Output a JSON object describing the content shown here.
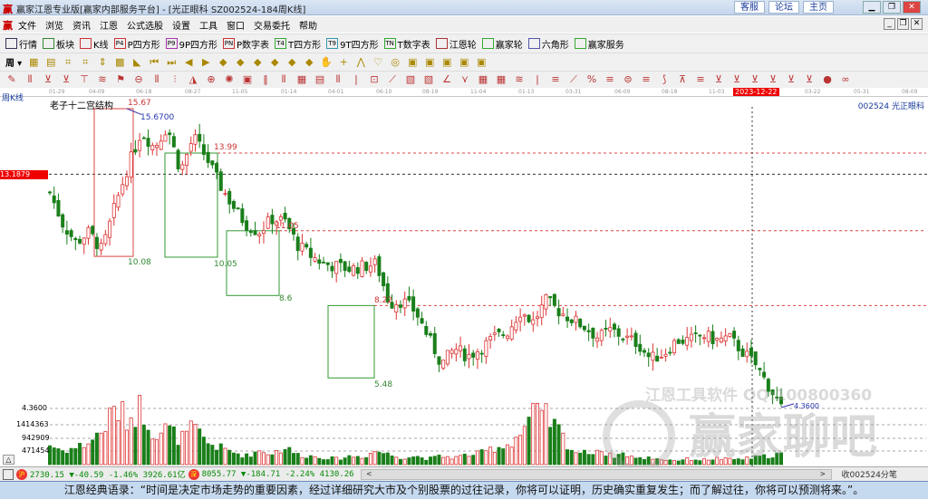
{
  "window": {
    "title": "赢家江恩专业版[赢家内部服务平台] - [光正眼科   SZ002524-184周K线]",
    "links": [
      "客服",
      "论坛",
      "主页"
    ]
  },
  "menu": [
    "文件",
    "浏览",
    "资讯",
    "江恩",
    "公式选股",
    "设置",
    "工具",
    "窗口",
    "交易委托",
    "帮助"
  ],
  "toolbar": [
    {
      "icon": "grid-icon",
      "label": "行情"
    },
    {
      "icon": "blocks-icon",
      "label": "板块"
    },
    {
      "icon": "candles-icon",
      "label": "K线"
    },
    {
      "icon": "P4",
      "label": "P四方形"
    },
    {
      "icon": "P9",
      "label": "9P四方形"
    },
    {
      "icon": "PN",
      "label": "P数字表"
    },
    {
      "icon": "T4",
      "label": "T四方形"
    },
    {
      "icon": "T9",
      "label": "9T四方形"
    },
    {
      "icon": "TN",
      "label": "T数字表"
    },
    {
      "icon": "target-icon",
      "label": "江恩轮"
    },
    {
      "icon": "wheel-icon",
      "label": "赢家轮"
    },
    {
      "icon": "hexagon-icon",
      "label": "六角形"
    },
    {
      "icon": "dollar-icon",
      "label": "赢家服务"
    }
  ],
  "period_select": "周",
  "chart": {
    "period_label": "周K线",
    "structure_label": "老子十二宫结构",
    "stock": "002524  光正眼科",
    "cursor_price": "13.1879",
    "cursor_date": "2023-12-22",
    "dates": [
      "01-29",
      "04-09",
      "06-18",
      "08-27",
      "11-05",
      "01-14",
      "04-01",
      "06-10",
      "08-19",
      "11-04",
      "01-13",
      "03-31",
      "06-09",
      "08-18",
      "11-03",
      "03-22",
      "05-31",
      "08-09"
    ],
    "high_label": "15.6700",
    "low_label": "4.3600",
    "box_labels": {
      "top1": "15.67",
      "bot1": "10.08",
      "top2": "13.99",
      "bot2": "10.05",
      "top3": "11.05",
      "bot3": "8.6",
      "top4": "8.22",
      "bot4": "5.48"
    },
    "volume_ticks": [
      "4.3600",
      "1414363",
      "942909",
      "471454"
    ],
    "watermark1": "江恩工具软件  QQ:100800360",
    "watermark2": "赢家聊吧"
  },
  "chart_data": {
    "type": "candlestick",
    "price_range": [
      4.36,
      15.67
    ],
    "close_path": [
      12.5,
      11.3,
      10.6,
      11,
      10.3,
      12,
      13.5,
      14.8,
      14.2,
      15.0,
      13.3,
      14.6,
      13.8,
      12.8,
      12.0,
      11.3,
      11.0,
      11.5,
      11.4,
      10.5,
      10.1,
      9.8,
      9.7,
      9.6,
      9.7,
      9.8,
      8.3,
      8.4,
      8.0,
      7.0,
      6.0,
      6.6,
      6.3,
      6.6,
      7.0,
      7.2,
      8.0,
      7.6,
      8.4,
      8.0,
      7.7,
      7.4,
      7.0,
      7.3,
      7.0,
      6.8,
      6.2,
      6.4,
      6.9,
      6.9,
      7.1,
      6.9,
      7.0,
      6.5,
      6.0,
      5.2,
      4.4
    ],
    "volume_path": [
      700000,
      500000,
      600000,
      800000,
      1200000,
      2000000,
      1600000,
      2100000,
      1100000,
      1300000,
      900000,
      1300000,
      800000,
      600000,
      450000,
      300000,
      500000,
      400000,
      600000,
      350000,
      300000,
      250000,
      200000,
      300000,
      280000,
      500000,
      350000,
      250000,
      300000,
      200000,
      300000,
      250000,
      350000,
      400000,
      600000,
      700000,
      1100000,
      1800000,
      1700000,
      1200000,
      500000,
      400000,
      550000,
      300000,
      400000,
      200000,
      250000,
      180000,
      150000,
      200000,
      160000,
      220000,
      180000,
      200000,
      250000,
      300000,
      400000
    ]
  },
  "status": {
    "sh": "2730.15 ▼-40.59 -1.46% 3926.61亿",
    "sz": "8055.77 ▼-184.71 -2.24% 4130.26",
    "right": "收002524分笔"
  },
  "quote": "江恩经典语录：“时间是决定市场走势的重要因素，经过详细研究大市及个别股票的过往记录，你将可以证明，历史确实重复发生；而了解过往，你将可以预测将来。”。"
}
